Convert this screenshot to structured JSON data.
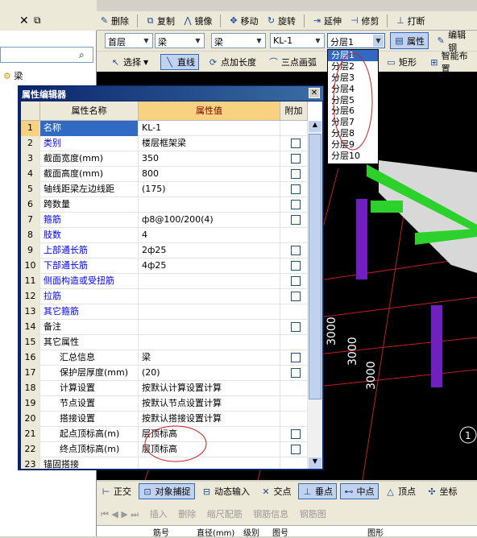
{
  "top_toolbar": {
    "delete": "删除",
    "copy": "复制",
    "mirror": "镜像",
    "move": "移动",
    "rotate": "旋转",
    "extend": "延伸",
    "trim": "修剪",
    "break": "打断"
  },
  "left_toolbar": {
    "item_label": "梁"
  },
  "selectors": {
    "floor": "首层",
    "category": "梁",
    "type": "梁",
    "element": "KL-1",
    "layer": "分层1"
  },
  "buttons": {
    "property": "属性",
    "edit_rebar": "编辑钢",
    "select": "选择",
    "line": "直线",
    "point_length": "点加长度",
    "three_point_arc": "三点画弧",
    "rect": "矩形",
    "smart": "智能布置"
  },
  "layer_dropdown": [
    "分层1",
    "分层2",
    "分层3",
    "分层4",
    "分层5",
    "分层6",
    "分层7",
    "分层8",
    "分层9",
    "分层10"
  ],
  "property_editor": {
    "title": "属性编辑器",
    "headers": {
      "name": "属性名称",
      "value": "属性值",
      "attach": "附加"
    },
    "rows": [
      {
        "n": "1",
        "name": "名称",
        "value": "KL-1",
        "blue": true,
        "cb": false
      },
      {
        "n": "2",
        "name": "类别",
        "value": "楼层框架梁",
        "blue": true,
        "cb": true
      },
      {
        "n": "3",
        "name": "截面宽度(mm)",
        "value": "350",
        "blue": false,
        "cb": true
      },
      {
        "n": "4",
        "name": "截面高度(mm)",
        "value": "800",
        "blue": false,
        "cb": true
      },
      {
        "n": "5",
        "name": "轴线距梁左边线距",
        "value": "(175)",
        "blue": false,
        "cb": true
      },
      {
        "n": "6",
        "name": "跨数量",
        "value": "",
        "blue": false,
        "cb": true
      },
      {
        "n": "7",
        "name": "箍筋",
        "value": "ф8@100/200(4)",
        "blue": true,
        "cb": true
      },
      {
        "n": "8",
        "name": "肢数",
        "value": "4",
        "blue": true,
        "cb": false
      },
      {
        "n": "9",
        "name": "上部通长筋",
        "value": "2ф25",
        "blue": true,
        "cb": true
      },
      {
        "n": "10",
        "name": "下部通长筋",
        "value": "4ф25",
        "blue": true,
        "cb": true
      },
      {
        "n": "11",
        "name": "侧面构造或受扭筋",
        "value": "",
        "blue": true,
        "cb": true
      },
      {
        "n": "12",
        "name": "拉筋",
        "value": "",
        "blue": true,
        "cb": true
      },
      {
        "n": "13",
        "name": "其它箍筋",
        "value": "",
        "blue": true,
        "cb": false
      },
      {
        "n": "14",
        "name": "备注",
        "value": "",
        "blue": false,
        "cb": true
      },
      {
        "n": "15",
        "name": "其它属性",
        "value": "",
        "blue": false,
        "cb": false
      },
      {
        "n": "16",
        "name": "汇总信息",
        "value": "梁",
        "blue": false,
        "cb": true
      },
      {
        "n": "17",
        "name": "保护层厚度(mm)",
        "value": "(20)",
        "blue": false,
        "cb": true
      },
      {
        "n": "18",
        "name": "计算设置",
        "value": "按默认计算设置计算",
        "blue": false,
        "cb": false
      },
      {
        "n": "19",
        "name": "节点设置",
        "value": "按默认节点设置计算",
        "blue": false,
        "cb": false
      },
      {
        "n": "20",
        "name": "搭接设置",
        "value": "按默认搭接设置计算",
        "blue": false,
        "cb": false
      },
      {
        "n": "21",
        "name": "起点顶标高(m)",
        "value": "层顶标高",
        "blue": false,
        "cb": true
      },
      {
        "n": "22",
        "name": "终点顶标高(m)",
        "value": "层顶标高",
        "blue": false,
        "cb": true
      },
      {
        "n": "23",
        "name": "锚固搭接",
        "value": "",
        "blue": false,
        "cb": false
      }
    ]
  },
  "canvas": {
    "labels": [
      "3000",
      "3000",
      "3000"
    ],
    "corner": "1"
  },
  "bottom_toolbar": {
    "ortho": "正交",
    "snap": "对象捕捉",
    "dyn_input": "动态输入",
    "intersect": "交点",
    "perp": "垂点",
    "mid": "中点",
    "vertex": "顶点",
    "coord": "坐标"
  },
  "bottom_toolbar2": {
    "insert": "插入",
    "delete": "删除",
    "scale": "缩尺配筋",
    "rebar_info": "钢筋信息",
    "rebar_lib": "钢筋图"
  },
  "bottom_headers": [
    "筋号",
    "直径(mm)",
    "级别",
    "图号",
    "图形"
  ]
}
